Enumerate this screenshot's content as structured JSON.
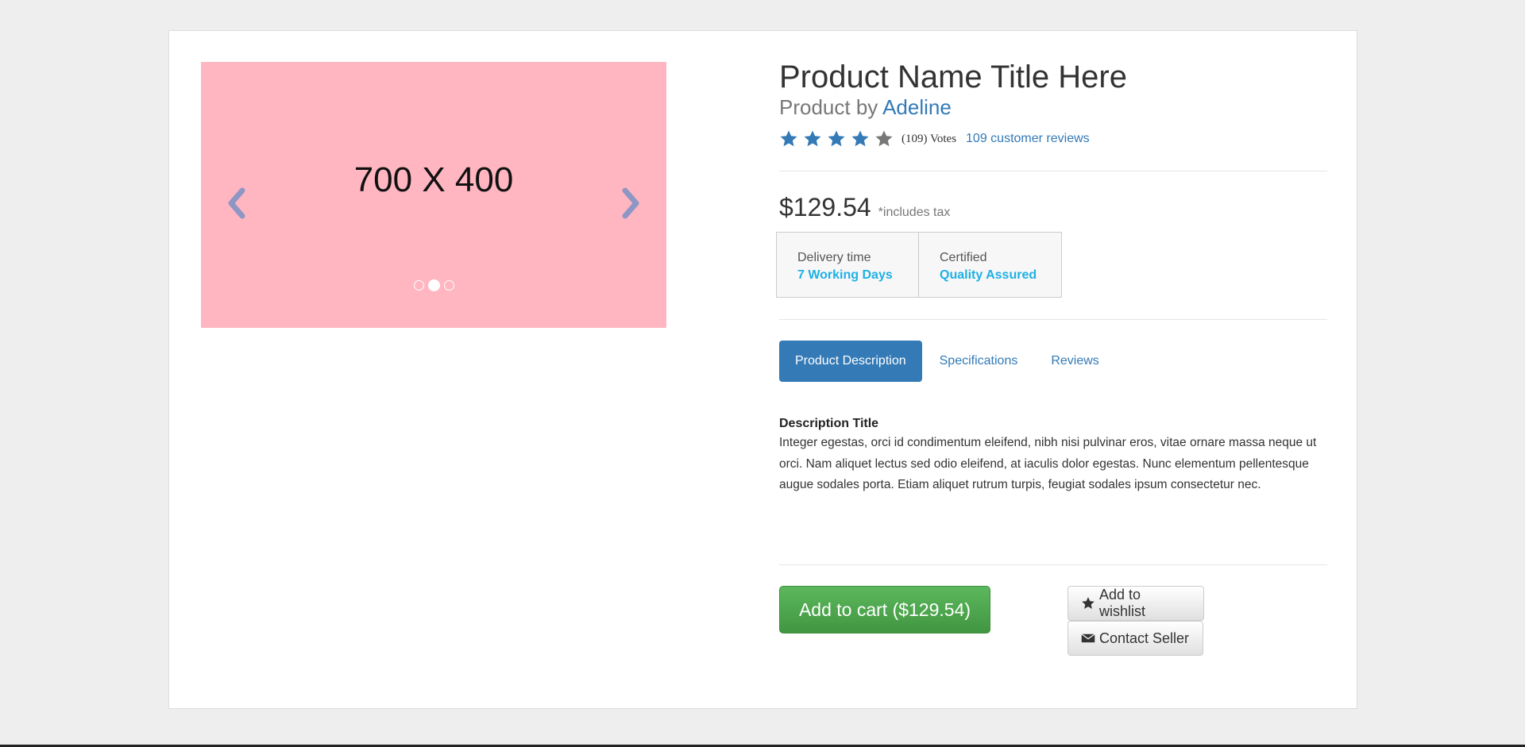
{
  "carousel": {
    "placeholder_text": "700 X 400",
    "indicator_count": 3,
    "active_index": 1
  },
  "product": {
    "title": "Product Name Title Here",
    "by_prefix": "Product by",
    "seller": "Adeline",
    "rating": 4,
    "rating_max": 5,
    "votes": "(109) Votes",
    "reviews_link": "109 customer reviews",
    "price": "$129.54",
    "tax_note": "*includes tax"
  },
  "features": [
    {
      "label": "Delivery time",
      "value": "7 Working Days"
    },
    {
      "label": "Certified",
      "value": "Quality Assured"
    }
  ],
  "tabs": [
    {
      "label": "Product Description",
      "active": true
    },
    {
      "label": "Specifications",
      "active": false
    },
    {
      "label": "Reviews",
      "active": false
    }
  ],
  "description": {
    "title": "Description Title",
    "body": "Integer egestas, orci id condimentum eleifend, nibh nisi pulvinar eros, vitae ornare massa neque ut orci. Nam aliquet lectus sed odio eleifend, at iaculis dolor egestas. Nunc elementum pellentesque augue sodales porta. Etiam aliquet rutrum turpis, feugiat sodales ipsum consectetur nec."
  },
  "actions": {
    "cart_label": "Add to cart ($129.54)",
    "wishlist_label": "Add to wishlist",
    "contact_label": "Contact Seller"
  },
  "icons": {
    "star_filled": "star-icon",
    "star_empty": "star-icon",
    "wishlist": "star-icon",
    "contact": "envelope-icon",
    "prev": "chevron-left-icon",
    "next": "chevron-right-icon"
  },
  "colors": {
    "accent": "#337ab7",
    "feature_value": "#1eb0e6",
    "cart_button": "#4cae4c",
    "carousel_bg": "#ffb6c1",
    "star_empty": "#777777"
  }
}
